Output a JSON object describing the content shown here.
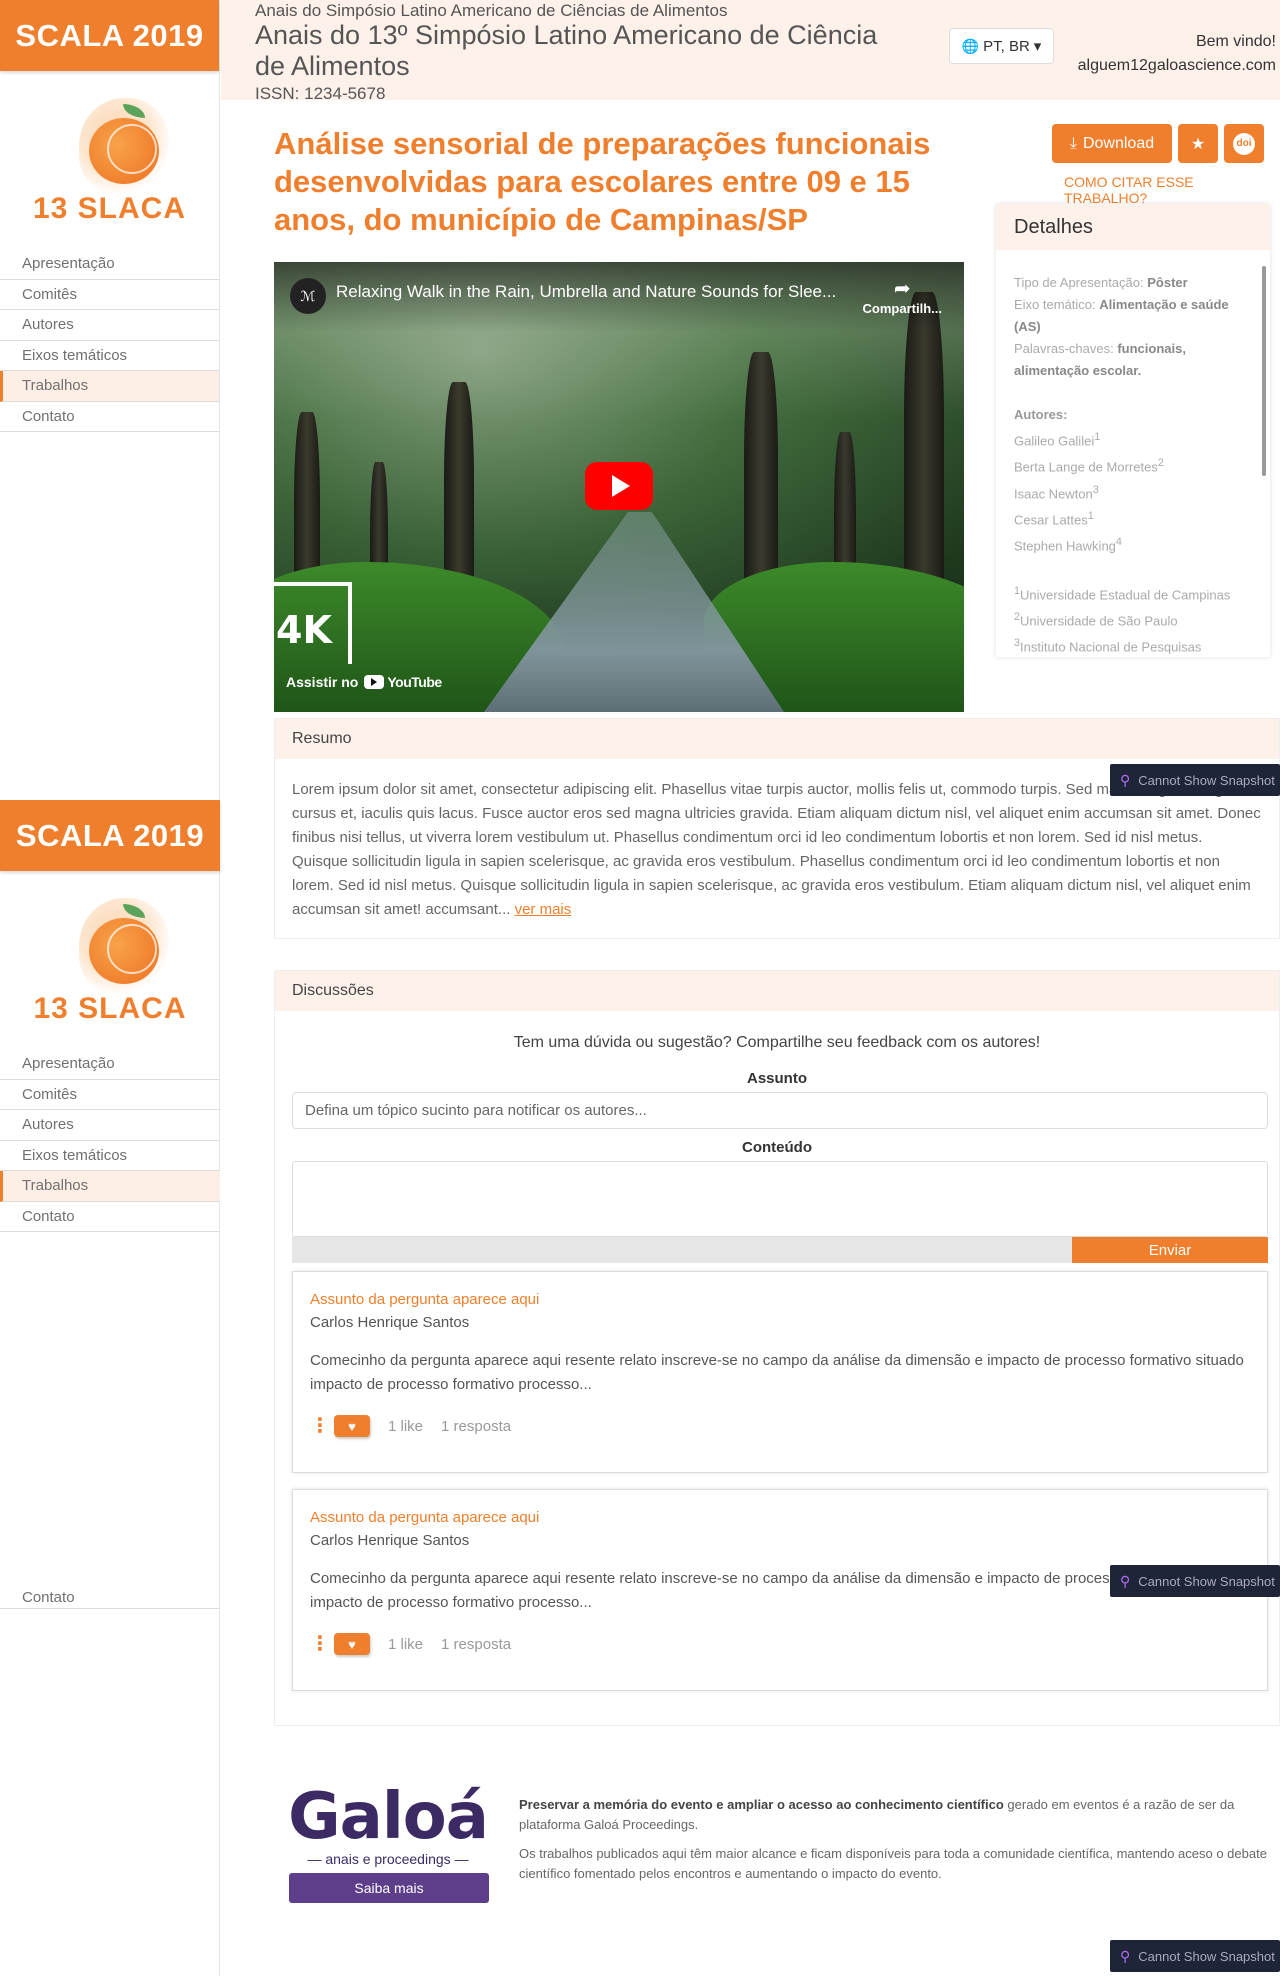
{
  "brand": "SCALA 2019",
  "logo_text": "13 SLACA",
  "nav": [
    {
      "label": "Apresentação"
    },
    {
      "label": "Comitês"
    },
    {
      "label": "Autores"
    },
    {
      "label": "Eixos temáticos"
    },
    {
      "label": "Trabalhos"
    },
    {
      "label": "Contato"
    }
  ],
  "nav_active": "Trabalhos",
  "header": {
    "series": "Anais do Simpósio Latino Americano de Ciências de Alimentos",
    "title": "Anais do 13º Simpósio Latino Americano de Ciência de Alimentos",
    "issn": "ISSN: 1234-5678",
    "language": "PT, BR",
    "welcome": "Bem vindo!",
    "user_email": "alguem12galoascience.com"
  },
  "paper": {
    "title": "Análise sensorial de preparações funcionais desenvolvidas para escolares entre 09 e 15 anos, do município de Campinas/SP",
    "download_label": "Download",
    "doi_label": "doi",
    "cite_link": "COMO CITAR ESSE TRABALHO?"
  },
  "details": {
    "heading": "Detalhes",
    "presentation_label": "Tipo de Apresentação:",
    "presentation_value": "Pôster",
    "axis_label": "Eixo temático:",
    "axis_value": "Alimentação e saúde (AS)",
    "keywords_label": "Palavras-chaves:",
    "keywords_value": "funcionais, alimentação escolar.",
    "authors_label": "Autores:",
    "authors": [
      {
        "name": "Galileo Galilei",
        "sup": "1"
      },
      {
        "name": "Berta Lange de Morretes",
        "sup": "2"
      },
      {
        "name": "Isaac Newton",
        "sup": "3"
      },
      {
        "name": "Cesar Lattes",
        "sup": "1"
      },
      {
        "name": "Stephen Hawking",
        "sup": "4"
      }
    ],
    "affiliations": [
      {
        "sup": "1",
        "name": "Universidade Estadual de Campinas"
      },
      {
        "sup": "2",
        "name": "Universidade de São Paulo"
      },
      {
        "sup": "3",
        "name": "Instituto Nacional de Pesquisas"
      }
    ]
  },
  "video": {
    "title": "Relaxing Walk in the Rain, Umbrella and Nature Sounds for Slee...",
    "share_label": "Compartilh...",
    "badge": "4K",
    "watch_on": "Assistir no",
    "platform": "YouTube"
  },
  "resumo": {
    "heading": "Resumo",
    "text": "Lorem ipsum dolor sit amet, consectetur adipiscing elit. Phasellus vitae turpis auctor, mollis felis ut, commodo turpis. Sed mauris, egestas eget cursus et, iaculis quis lacus. Fusce auctor eros sed magna ultricies gravida. Etiam aliquam dictum nisl, vel aliquet enim accumsan sit amet. Donec finibus nisi tellus, ut viverra lorem vestibulum ut. Phasellus condimentum orci id leo condimentum lobortis et non lorem. Sed id nisl metus. Quisque sollicitudin ligula in sapien scelerisque, ac gravida eros vestibulum. Phasellus condimentum orci id leo condimentum lobortis et non lorem. Sed id nisl metus. Quisque sollicitudin ligula in sapien scelerisque, ac gravida eros vestibulum. Etiam aliquam dictum nisl, vel aliquet enim accumsan sit amet! accumsant...",
    "more_label": "ver mais"
  },
  "discussions": {
    "heading": "Discussões",
    "intro": "Tem uma dúvida ou sugestão? Compartilhe seu feedback com os autores!",
    "subject_label": "Assunto",
    "subject_placeholder": "Defina um tópico sucinto para notificar os autores...",
    "content_label": "Conteúdo",
    "send_label": "Enviar",
    "questions": [
      {
        "subject": "Assunto da pergunta aparece aqui",
        "author": "Carlos Henrique Santos",
        "text": "Comecinho da pergunta aparece aqui resente relato inscreve-se no campo da análise da dimensão e impacto de processo formativo situado impacto de processo formativo processo...",
        "likes": "1 like",
        "replies": "1 resposta"
      },
      {
        "subject": "Assunto da pergunta aparece aqui",
        "author": "Carlos Henrique Santos",
        "text": "Comecinho da pergunta aparece aqui resente relato inscreve-se no campo da análise da dimensão e impacto de processo formativo situado impacto de processo formativo processo...",
        "likes": "1 like",
        "replies": "1 resposta"
      }
    ]
  },
  "footer": {
    "logo_word": "Galoá",
    "logo_sub": "anais e proceedings",
    "cta": "Saiba mais",
    "p1_bold": "Preservar a memória do evento e ampliar o acesso ao conhecimento científico",
    "p1_rest": "gerado em eventos é a razão de ser da plataforma Galoá Proceedings.",
    "p2": "Os trabalhos publicados aqui têm maior alcance e ficam disponíveis para toda a comunidade científica, mantendo aceso o debate científico fomentado pelos encontros e aumentando o impacto do evento."
  },
  "snapshot_overlay": "Cannot Show Snapshot",
  "ghost_nav_label": "Contato",
  "colors": {
    "accent": "#f07f2d",
    "header_bg": "#fdf1ea",
    "galoa_purple": "#3b2a63"
  }
}
